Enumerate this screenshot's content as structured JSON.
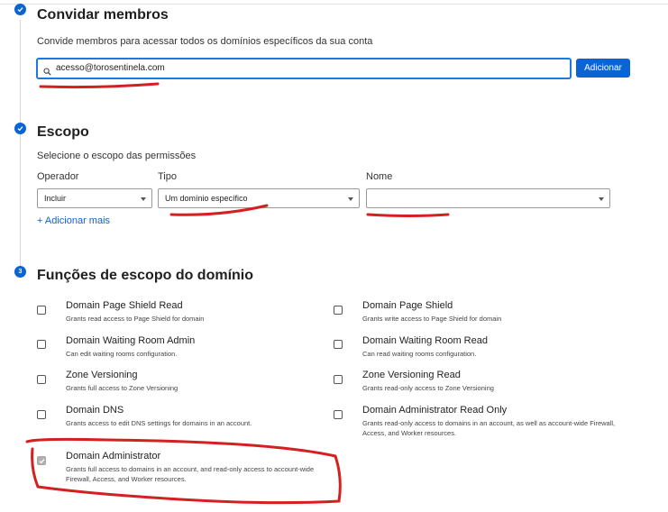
{
  "invite": {
    "title": "Convidar membros",
    "subtitle": "Convide membros para acessar todos os domínios específicos da sua conta",
    "email_value": "acesso@torosentinela.com",
    "add_button": "Adicionar"
  },
  "scope": {
    "title": "Escopo",
    "subtitle": "Selecione o escopo das permissões",
    "operator_label": "Operador",
    "operator_value": "Incluir",
    "type_label": "Tipo",
    "type_value": "Um domínio específico",
    "name_label": "Nome",
    "name_value": "",
    "add_more": "+ Adicionar mais"
  },
  "roles": {
    "step_number": "3",
    "title": "Funções de escopo do domínio",
    "items": [
      {
        "name": "Domain Page Shield Read",
        "desc": "Grants read access to Page Shield for domain",
        "checked": false
      },
      {
        "name": "Domain Page Shield",
        "desc": "Grants write access to Page Shield for domain",
        "checked": false
      },
      {
        "name": "Domain Waiting Room Admin",
        "desc": "Can edit waiting rooms configuration.",
        "checked": false
      },
      {
        "name": "Domain Waiting Room Read",
        "desc": "Can read waiting rooms configuration.",
        "checked": false
      },
      {
        "name": "Zone Versioning",
        "desc": "Grants full access to Zone Versioning",
        "checked": false
      },
      {
        "name": "Zone Versioning Read",
        "desc": "Grants read-only access to Zone Versioning",
        "checked": false
      },
      {
        "name": "Domain DNS",
        "desc": "Grants access to edit DNS settings for domains in an account.",
        "checked": false
      },
      {
        "name": "Domain Administrator Read Only",
        "desc": "Grants read-only access to domains in an account, as well as account-wide Firewall, Access, and Worker resources.",
        "checked": false
      },
      {
        "name": "Domain Administrator",
        "desc": "Grants full access to domains in an account, and read-only access to account-wide Firewall, Access, and Worker resources.",
        "checked": true
      }
    ]
  },
  "colors": {
    "accent": "#0b64d4",
    "annotation": "#d42020"
  }
}
